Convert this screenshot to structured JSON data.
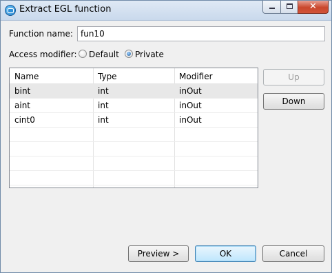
{
  "window": {
    "title": "Extract EGL function",
    "close_glyph": "✕"
  },
  "form": {
    "function_name_label": "Function name:",
    "function_name_value": "fun10",
    "access_modifier_label": "Access modifier:",
    "access_options": [
      "Default",
      "Private"
    ],
    "access_selected": "Private"
  },
  "table": {
    "columns": [
      "Name",
      "Type",
      "Modifier"
    ],
    "rows": [
      {
        "name": "bint",
        "type": "int",
        "modifier": "inOut",
        "selected": true
      },
      {
        "name": "aint",
        "type": "int",
        "modifier": "inOut",
        "selected": false
      },
      {
        "name": "cint0",
        "type": "int",
        "modifier": "inOut",
        "selected": false
      }
    ]
  },
  "side_buttons": {
    "up_label": "Up",
    "down_label": "Down"
  },
  "footer": {
    "preview_label": "Preview >",
    "ok_label": "OK",
    "cancel_label": "Cancel"
  },
  "icons": {
    "app": "egl-app-icon",
    "minimize": "minimize-icon",
    "maximize": "maximize-icon",
    "close": "close-icon"
  }
}
